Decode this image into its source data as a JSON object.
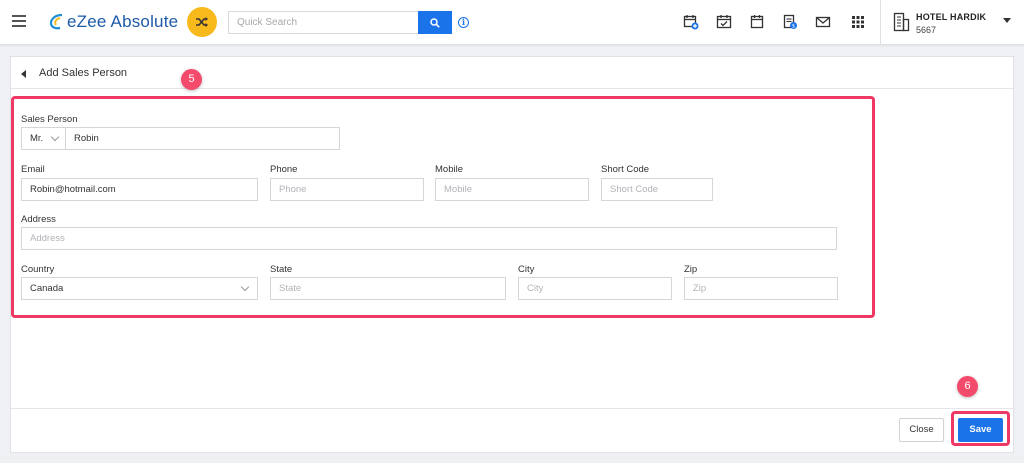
{
  "header": {
    "app_name": "eZee Absolute",
    "search_placeholder": "Quick Search",
    "hotel_name": "HOTEL HARDIK",
    "hotel_code": "5667",
    "icons": [
      "calendar-add-icon",
      "calendar-check-icon",
      "calendar-icon",
      "invoice-icon",
      "mail-icon",
      "apps-grid-icon"
    ]
  },
  "panel": {
    "title": "Add Sales Person",
    "step_form": "5",
    "step_save": "6"
  },
  "form": {
    "sales_person_label": "Sales Person",
    "salutation": "Mr.",
    "name_value": "Robin",
    "email_label": "Email",
    "email_value": "Robin@hotmail.com",
    "phone_label": "Phone",
    "phone_placeholder": "Phone",
    "mobile_label": "Mobile",
    "mobile_placeholder": "Mobile",
    "shortcode_label": "Short Code",
    "shortcode_placeholder": "Short Code",
    "address_label": "Address",
    "address_placeholder": "Address",
    "country_label": "Country",
    "country_value": "Canada",
    "state_label": "State",
    "state_placeholder": "State",
    "city_label": "City",
    "city_placeholder": "City",
    "zip_label": "Zip",
    "zip_placeholder": "Zip"
  },
  "footer": {
    "close_label": "Close",
    "save_label": "Save"
  },
  "colors": {
    "primary": "#1a73e8",
    "highlight": "#f03865",
    "accent": "#f7b91c",
    "logo": "#1e5aa8"
  }
}
